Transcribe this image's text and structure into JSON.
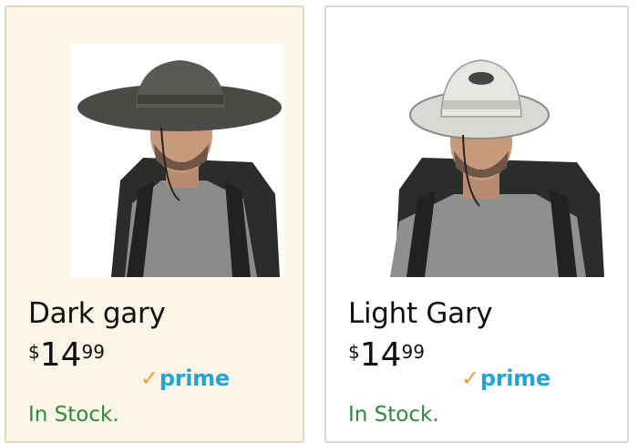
{
  "products": [
    {
      "name": "Dark gary",
      "price_symbol": "$",
      "price_whole": "14",
      "price_fraction": "99",
      "prime_check": "✓",
      "prime_label": "prime",
      "stock": "In Stock.",
      "hat_color": "#4a4a46"
    },
    {
      "name": "Light Gary",
      "price_symbol": "$",
      "price_whole": "14",
      "price_fraction": "99",
      "prime_check": "✓",
      "prime_label": "prime",
      "stock": "In Stock.",
      "hat_color": "#d9d9d6"
    }
  ],
  "colors": {
    "prime_blue": "#22a5d6",
    "prime_check_orange": "#f0a030",
    "in_stock_green": "#2f8a3a",
    "selected_card_bg": "#faf5e6"
  }
}
